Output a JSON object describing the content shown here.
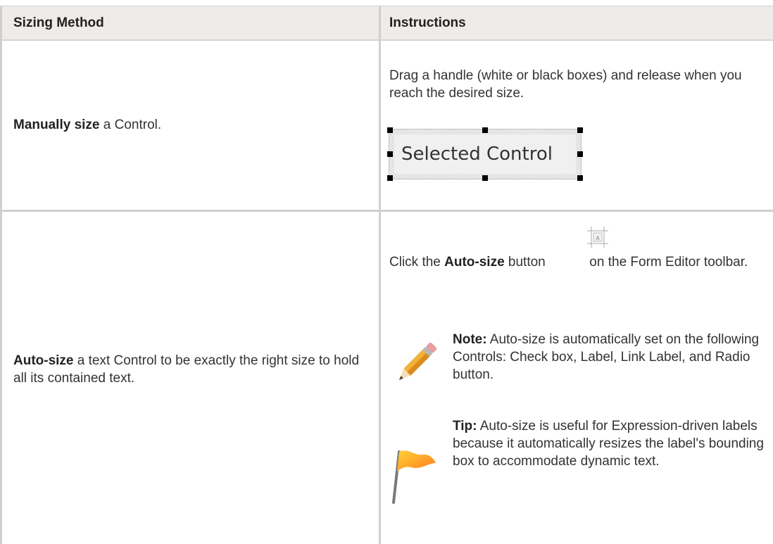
{
  "table": {
    "headers": [
      "Sizing Method",
      "Instructions"
    ],
    "rows": [
      {
        "method_bold": "Manually size",
        "method_rest": " a Control.",
        "instruction": "Drag a handle (white or black boxes) and release when you reach the desired size.",
        "control_label": "Selected Control"
      },
      {
        "method_bold": "Auto-size",
        "method_rest": " a text Control to be exactly the right size to hold all its contained text.",
        "instr_pre": "Click the ",
        "instr_bold": "Auto-size",
        "instr_mid": " button ",
        "instr_post": " on the Form Editor toolbar.",
        "note_label": "Note:",
        "note_text": " Auto-size is automatically set on the following Controls: Check box, Label, Link Label, and Radio button.",
        "tip_label": "Tip:",
        "tip_text": " Auto-size is useful for Expression-driven labels because it automatically resizes the label's bounding box to accommodate dynamic text."
      }
    ]
  },
  "icons": {
    "auto_size": "auto-size-icon",
    "note": "pencil-icon",
    "tip": "flag-icon"
  },
  "colors": {
    "header_bg": "#efebe9",
    "grid": "#cfcfcf",
    "text": "#333333"
  }
}
